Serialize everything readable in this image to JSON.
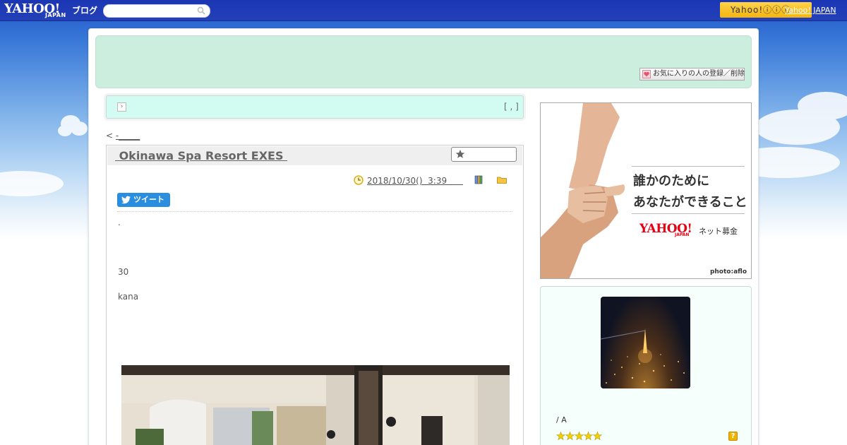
{
  "header": {
    "logo_text": "YAHOO!",
    "logo_sub": "JAPAN",
    "logo_blog": "ブログ",
    "search_placeholder": "",
    "yahoo_button": "Yahoo!ⓘⓘⓘ",
    "yahoo_japan_link": "Yahoo! JAPAN"
  },
  "banner": {
    "favorite_button": "お気に入りの人の登録／削除"
  },
  "nav": {
    "arrow": "›",
    "bracket": "[ , ]",
    "prev_link_prefix": "< ",
    "prev_link_text": "-_____"
  },
  "article": {
    "title": " Okinawa Spa Resort EXES ",
    "date": "2018/10/30()  3:39      ",
    "tweet_label": "ツイート",
    "lines": [
      ".",
      "30",
      "kana"
    ]
  },
  "sidebar": {
    "ad": {
      "line1": "誰かのために",
      "line2": "あなたができること",
      "brand": "YAHOO!",
      "brand_sub": "JAPAN",
      "service": "ネット募金",
      "credit": "photo:aflo"
    },
    "profile": {
      "name": "/ A",
      "help": "?"
    }
  },
  "colors": {
    "header_blue": "#2440b8",
    "banner_green": "#cbeede",
    "nav_mint": "#d2fbf1",
    "tweet_blue": "#2a8ee0",
    "yahoo_yellow": "#f3b410",
    "yahoo_red": "#e60012"
  }
}
